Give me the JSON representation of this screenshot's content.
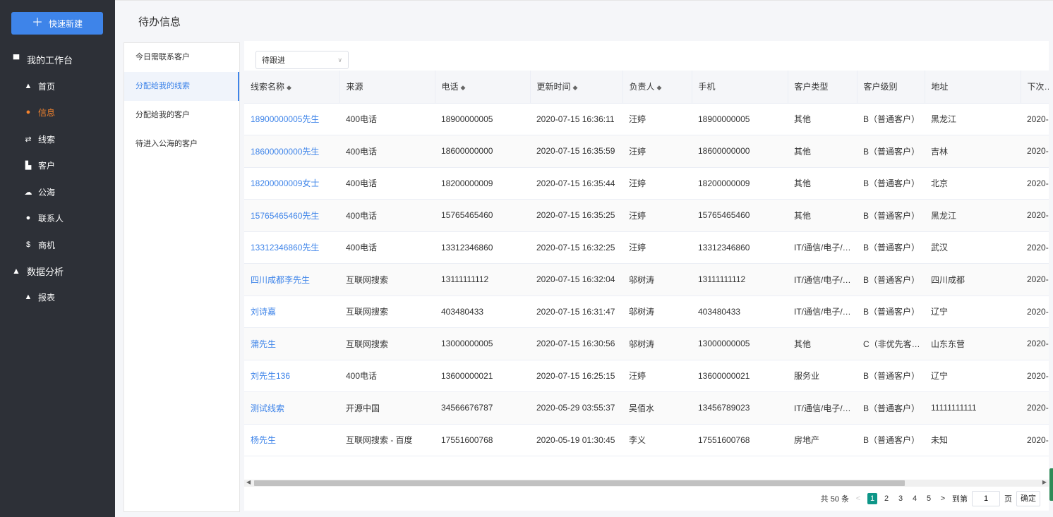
{
  "sidebar": {
    "quick_create": "快速新建",
    "groups": [
      {
        "label": "我的工作台"
      },
      {
        "label": "数据分析"
      }
    ],
    "items": [
      {
        "label": "首页"
      },
      {
        "label": "信息"
      },
      {
        "label": "线索"
      },
      {
        "label": "客户"
      },
      {
        "label": "公海"
      },
      {
        "label": "联系人"
      },
      {
        "label": "商机"
      },
      {
        "label": "报表"
      }
    ]
  },
  "header": {
    "title": "待办信息"
  },
  "submenu": {
    "items": [
      {
        "label": "今日需联系客户"
      },
      {
        "label": "分配给我的线索"
      },
      {
        "label": "分配给我的客户"
      },
      {
        "label": "待进入公海的客户"
      }
    ]
  },
  "filter": {
    "selected": "待跟进"
  },
  "table": {
    "columns": [
      "线索名称",
      "来源",
      "电话",
      "更新时间",
      "负责人",
      "手机",
      "客户类型",
      "客户级别",
      "地址",
      "下次联系时间"
    ],
    "rows": [
      [
        "18900000005先生",
        "400电话",
        "18900000005",
        "2020-07-15 16:36:11",
        "汪婷",
        "18900000005",
        "其他",
        "B（普通客户）",
        "黑龙江",
        "2020-"
      ],
      [
        "18600000000先生",
        "400电话",
        "18600000000",
        "2020-07-15 16:35:59",
        "汪婷",
        "18600000000",
        "其他",
        "B（普通客户）",
        "吉林",
        "2020-"
      ],
      [
        "18200000009女士",
        "400电话",
        "18200000009",
        "2020-07-15 16:35:44",
        "汪婷",
        "18200000009",
        "其他",
        "B（普通客户）",
        "北京",
        "2020-"
      ],
      [
        "15765465460先生",
        "400电话",
        "15765465460",
        "2020-07-15 16:35:25",
        "汪婷",
        "15765465460",
        "其他",
        "B（普通客户）",
        "黑龙江",
        "2020-"
      ],
      [
        "13312346860先生",
        "400电话",
        "13312346860",
        "2020-07-15 16:32:25",
        "汪婷",
        "13312346860",
        "IT/通信/电子/互联网",
        "B（普通客户）",
        "武汉",
        "2020-"
      ],
      [
        "四川成都李先生",
        "互联网搜索",
        "13111111112",
        "2020-07-15 16:32:04",
        "邬树涛",
        "13111111112",
        "IT/通信/电子/互联网",
        "B（普通客户）",
        "四川成都",
        "2020-"
      ],
      [
        "刘诗嘉",
        "互联网搜索",
        "403480433",
        "2020-07-15 16:31:47",
        "邬树涛",
        "403480433",
        "IT/通信/电子/互联网",
        "B（普通客户）",
        "辽宁",
        "2020-"
      ],
      [
        "蒲先生",
        "互联网搜索",
        "13000000005",
        "2020-07-15 16:30:56",
        "邬树涛",
        "13000000005",
        "其他",
        "C（非优先客户）",
        "山东东营",
        "2020-"
      ],
      [
        "刘先生136",
        "400电话",
        "13600000021",
        "2020-07-15 16:25:15",
        "汪婷",
        "13600000021",
        "服务业",
        "B（普通客户）",
        "辽宁",
        "2020-"
      ],
      [
        "测试线索",
        "开源中国",
        "34566676787",
        "2020-05-29 03:55:37",
        "吴佰水",
        "13456789023",
        "IT/通信/电子/互联网",
        "B（普通客户）",
        "11111111111",
        "2020-"
      ],
      [
        "杨先生",
        "互联网搜索 - 百度",
        "17551600768",
        "2020-05-19 01:30:45",
        "李义",
        "17551600768",
        "房地产",
        "B（普通客户）",
        "未知",
        "2020-"
      ]
    ]
  },
  "pagination": {
    "total_text": "共 50 条",
    "prev": "<",
    "pages": [
      "1",
      "2",
      "3",
      "4",
      "5"
    ],
    "next": ">",
    "goto_label": "到第",
    "goto_value": "1",
    "page_unit": "页",
    "confirm": "确定"
  },
  "colors": {
    "sidebar_bg": "#2d3037",
    "accent_blue": "#3e84e9",
    "active_orange": "#f5832d",
    "pager_active": "#0e9688"
  }
}
